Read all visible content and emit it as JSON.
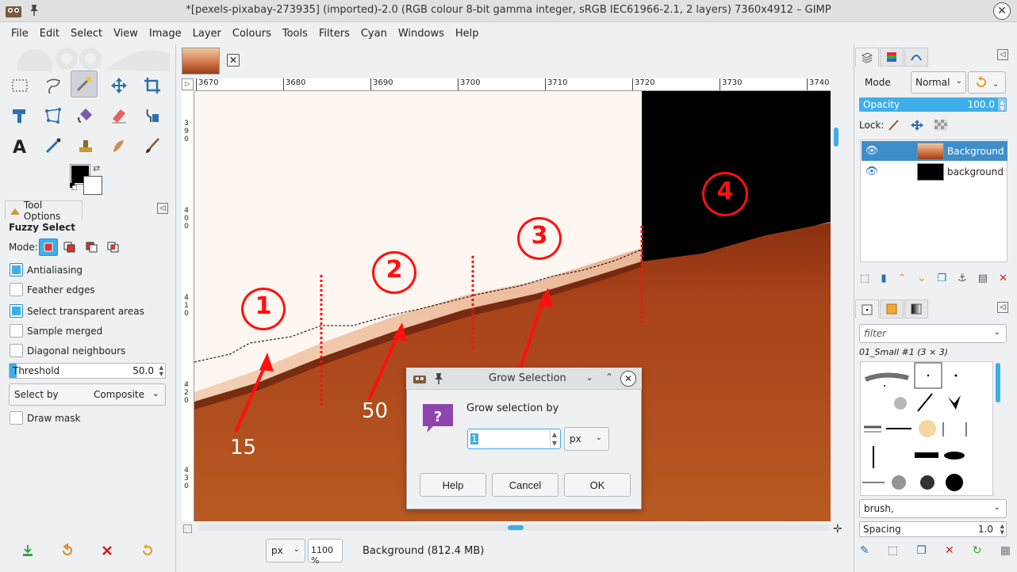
{
  "window": {
    "title": "*[pexels-pixabay-273935] (imported)-2.0 (RGB colour 8-bit gamma integer, sRGB IEC61966-2.1, 2 layers) 7360x4912 – GIMP",
    "close_glyph": "✕"
  },
  "menu": [
    "File",
    "Edit",
    "Select",
    "View",
    "Image",
    "Layer",
    "Colours",
    "Tools",
    "Filters",
    "Cyan",
    "Windows",
    "Help"
  ],
  "tool_options": {
    "tab_label": "Tool Options",
    "title": "Fuzzy Select",
    "mode_label": "Mode:",
    "options": [
      {
        "label": "Antialiasing",
        "checked": true
      },
      {
        "label": "Feather edges",
        "checked": false
      },
      {
        "label": "Select transparent areas",
        "checked": true
      },
      {
        "label": "Sample merged",
        "checked": false
      },
      {
        "label": "Diagonal neighbours",
        "checked": false
      }
    ],
    "threshold_label": "Threshold",
    "threshold_value": "50.0",
    "select_by_label": "Select by",
    "select_by_value": "Composite",
    "draw_mask_label": "Draw mask"
  },
  "image_window": {
    "ruler_x": [
      "3670",
      "3680",
      "3690",
      "3700",
      "3710",
      "3720",
      "3730",
      "3740"
    ],
    "ruler_y_groups": [
      [
        "3",
        "9",
        "0"
      ],
      [
        "4",
        "0",
        "0"
      ],
      [
        "4",
        "1",
        "0"
      ],
      [
        "4",
        "2",
        "0"
      ],
      [
        "4",
        "3",
        "0"
      ]
    ],
    "unit": "px",
    "zoom": "1100 %",
    "status": "Background (812.4 MB)"
  },
  "annotations": {
    "markers": [
      "1",
      "2",
      "3",
      "4"
    ],
    "values": [
      "15",
      "50"
    ],
    "color": "#ff1010"
  },
  "layers": {
    "mode_label": "Mode",
    "mode_value": "Normal",
    "opacity_label": "Opacity",
    "opacity_value": "100.0",
    "lock_label": "Lock:",
    "items": [
      {
        "name": "Background",
        "selected": true
      },
      {
        "name": "background",
        "selected": false
      }
    ]
  },
  "brushes": {
    "filter_placeholder": "filter",
    "current_brush": "01_Small #1 (3 × 3)",
    "tag_value": "brush,",
    "spacing_label": "Spacing",
    "spacing_value": "1.0"
  },
  "dialog": {
    "title": "Grow Selection",
    "label": "Grow selection by",
    "value": "1",
    "unit": "px",
    "buttons": {
      "help": "Help",
      "cancel": "Cancel",
      "ok": "OK"
    }
  },
  "colors": {
    "accent": "#3daee9",
    "sky": "#fdf3ec",
    "sand_dark": "#8a3010",
    "sand": "#b54a18",
    "annotation": "#ff1010"
  }
}
